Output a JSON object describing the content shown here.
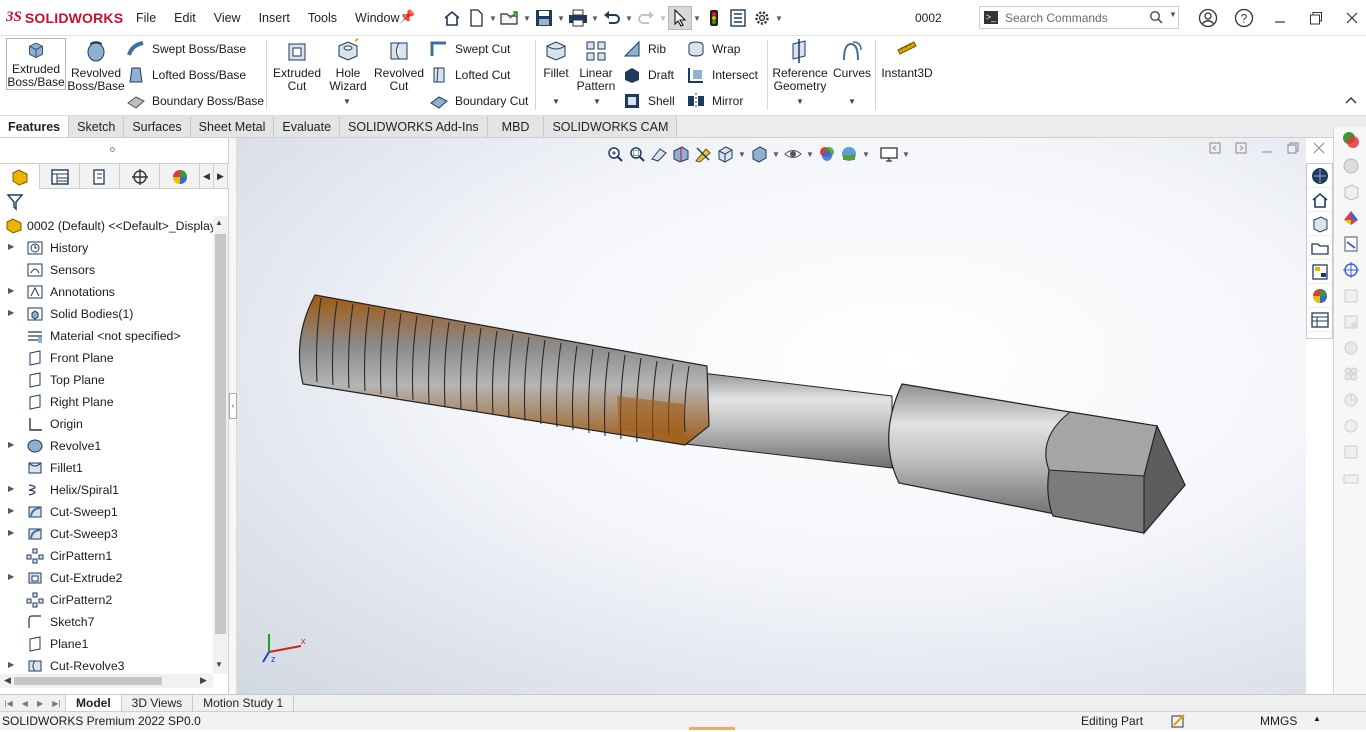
{
  "app": {
    "logo_ds": "3S",
    "logo_name": "SOLIDWORKS",
    "document_name": "0002",
    "search_placeholder": "Search Commands"
  },
  "menu": [
    "File",
    "Edit",
    "View",
    "Insert",
    "Tools",
    "Window"
  ],
  "ribbon": {
    "extruded_boss": "Extruded Boss/Base",
    "revolved_boss": "Revolved Boss/Base",
    "swept_boss": "Swept Boss/Base",
    "lofted_boss": "Lofted Boss/Base",
    "boundary_boss": "Boundary Boss/Base",
    "extruded_cut": "Extruded Cut",
    "hole_wizard": "Hole Wizard",
    "revolved_cut": "Revolved Cut",
    "swept_cut": "Swept Cut",
    "lofted_cut": "Lofted Cut",
    "boundary_cut": "Boundary Cut",
    "fillet": "Fillet",
    "linear_pattern": "Linear Pattern",
    "rib": "Rib",
    "draft": "Draft",
    "shell": "Shell",
    "wrap": "Wrap",
    "intersect": "Intersect",
    "mirror": "Mirror",
    "reference_geometry": "Reference Geometry",
    "curves": "Curves",
    "instant3d": "Instant3D"
  },
  "tabs": [
    "Features",
    "Sketch",
    "Surfaces",
    "Sheet Metal",
    "Evaluate",
    "SOLIDWORKS Add-Ins",
    "MBD",
    "SOLIDWORKS CAM"
  ],
  "tree": {
    "root": "0002 (Default) <<Default>_Display",
    "items": [
      {
        "label": "History",
        "icon": "history-icon",
        "expandable": true
      },
      {
        "label": "Sensors",
        "icon": "sensors-icon",
        "expandable": false
      },
      {
        "label": "Annotations",
        "icon": "annotations-icon",
        "expandable": true
      },
      {
        "label": "Solid Bodies(1)",
        "icon": "solid-bodies-icon",
        "expandable": true
      },
      {
        "label": "Material <not specified>",
        "icon": "material-icon",
        "expandable": false
      },
      {
        "label": "Front Plane",
        "icon": "plane-icon",
        "expandable": false
      },
      {
        "label": "Top Plane",
        "icon": "plane-icon",
        "expandable": false
      },
      {
        "label": "Right Plane",
        "icon": "plane-icon",
        "expandable": false
      },
      {
        "label": "Origin",
        "icon": "origin-icon",
        "expandable": false
      },
      {
        "label": "Revolve1",
        "icon": "revolve-icon",
        "expandable": true
      },
      {
        "label": "Fillet1",
        "icon": "fillet-icon",
        "expandable": false
      },
      {
        "label": "Helix/Spiral1",
        "icon": "helix-icon",
        "expandable": true
      },
      {
        "label": "Cut-Sweep1",
        "icon": "cut-sweep-icon",
        "expandable": true
      },
      {
        "label": "Cut-Sweep3",
        "icon": "cut-sweep-icon",
        "expandable": true
      },
      {
        "label": "CirPattern1",
        "icon": "circular-pattern-icon",
        "expandable": false
      },
      {
        "label": "Cut-Extrude2",
        "icon": "cut-extrude-icon",
        "expandable": true
      },
      {
        "label": "CirPattern2",
        "icon": "circular-pattern-icon",
        "expandable": false
      },
      {
        "label": "Sketch7",
        "icon": "sketch-icon",
        "expandable": false
      },
      {
        "label": "Plane1",
        "icon": "plane-icon",
        "expandable": false
      },
      {
        "label": "Cut-Revolve3",
        "icon": "cut-revolve-icon",
        "expandable": true
      }
    ]
  },
  "bottom_tabs": [
    "Model",
    "3D Views",
    "Motion Study 1"
  ],
  "status": {
    "version": "SOLIDWORKS Premium 2022 SP0.0",
    "mode": "Editing Part",
    "units": "MMGS"
  },
  "colors": {
    "brand": "#c8102e",
    "thread_bronze": "#a0601a",
    "shank_gray": "#b5b5b5"
  }
}
